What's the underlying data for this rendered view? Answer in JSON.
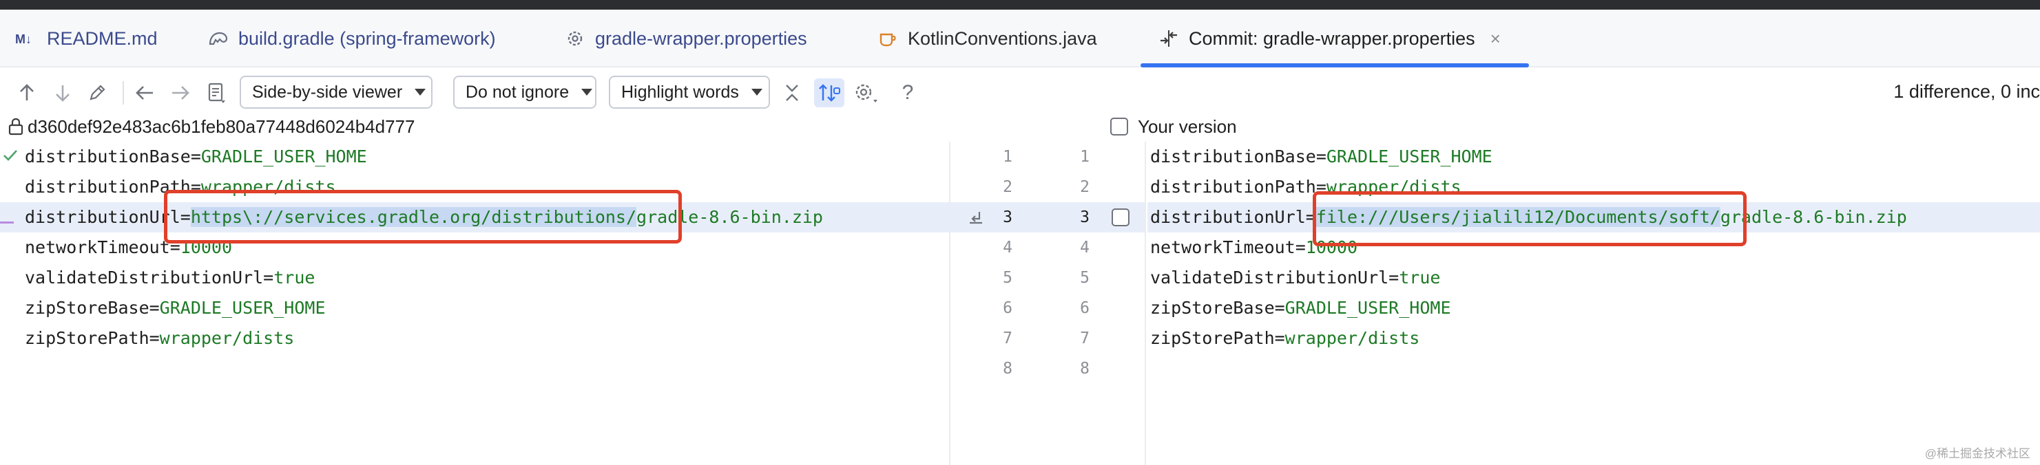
{
  "tabs": [
    {
      "label": "README.md",
      "icon": "markdown-icon"
    },
    {
      "label": "build.gradle (spring-framework)",
      "icon": "gradle-icon"
    },
    {
      "label": "gradle-wrapper.properties",
      "icon": "gear-icon"
    },
    {
      "label": "KotlinConventions.java",
      "icon": "java-class-icon"
    },
    {
      "label": "Commit: gradle-wrapper.properties",
      "icon": "commit-diff-icon",
      "close": "×"
    }
  ],
  "toolbar": {
    "viewer_mode": "Side-by-side viewer",
    "ignore_mode": "Do not ignore",
    "highlight_mode": "Highlight words",
    "help": "?",
    "summary": "1 difference, 0 inc"
  },
  "left_header": {
    "revision": "d360def92e483ac6b1feb80a77448d6024b4d777"
  },
  "right_header": {
    "label": "Your version"
  },
  "left_lines": [
    {
      "num": "1",
      "key": "distributionBase=",
      "value": "GRADLE_USER_HOME"
    },
    {
      "num": "2",
      "key": "distributionPath=",
      "value": "wrapper/dists"
    },
    {
      "num": "3",
      "key": "distributionUrl=",
      "value_changed": "https\\://services.gradle.org/distributions/",
      "value": "gradle-8.6-bin.zip"
    },
    {
      "num": "4",
      "key": "networkTimeout=",
      "value": "10000"
    },
    {
      "num": "5",
      "key": "validateDistributionUrl=",
      "value": "true"
    },
    {
      "num": "6",
      "key": "zipStoreBase=",
      "value": "GRADLE_USER_HOME"
    },
    {
      "num": "7",
      "key": "zipStorePath=",
      "value": "wrapper/dists"
    },
    {
      "num": "8",
      "key": "",
      "value": ""
    }
  ],
  "right_lines": [
    {
      "num": "1",
      "key": "distributionBase=",
      "value": "GRADLE_USER_HOME"
    },
    {
      "num": "2",
      "key": "distributionPath=",
      "value": "wrapper/dists"
    },
    {
      "num": "3",
      "key": "distributionUrl=",
      "value_changed": "file:///Users/jialili12/Documents/soft/",
      "value": "gradle-8.6-bin.zip"
    },
    {
      "num": "4",
      "key": "networkTimeout=",
      "value": "10000"
    },
    {
      "num": "5",
      "key": "validateDistributionUrl=",
      "value": "true"
    },
    {
      "num": "6",
      "key": "zipStoreBase=",
      "value": "GRADLE_USER_HOME"
    },
    {
      "num": "7",
      "key": "zipStorePath=",
      "value": "wrapper/dists"
    },
    {
      "num": "8",
      "key": "",
      "value": ""
    }
  ],
  "watermark": "@稀土掘金技术社区",
  "colors": {
    "accent": "#3574f0",
    "annotation": "#e0402a",
    "value_text": "#1d7a25",
    "changed_line": "#e8eef9"
  }
}
